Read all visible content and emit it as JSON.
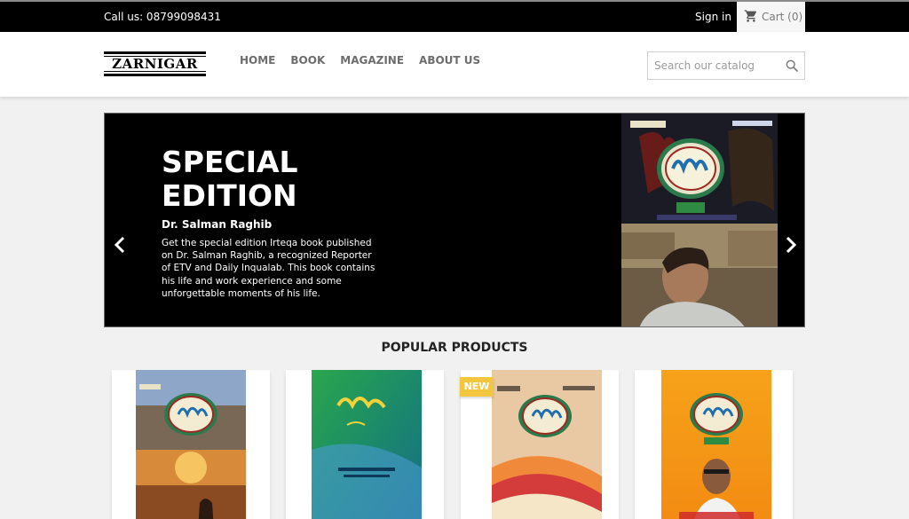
{
  "topbar": {
    "phone": "Call us: 08799098431",
    "signin": "Sign in",
    "cart": "Cart (0)"
  },
  "header": {
    "logo_text": "ZARNIGAR",
    "nav": [
      "HOME",
      "BOOK",
      "MAGAZINE",
      "ABOUT US"
    ],
    "search_placeholder": "Search our catalog"
  },
  "slider": {
    "title": "SPECIAL EDITION",
    "subtitle": "Dr. Salman Raghib",
    "description": "Get the special edition Irteqa book published on Dr. Salman Raghib, a recognized Reporter of ETV and Daily Inqualab. This book contains his life and work experience and some unforgettable moments of his life."
  },
  "popular": {
    "title": "POPULAR PRODUCTS",
    "new_badge": "NEW",
    "products": 4
  },
  "colors": {
    "topbar_bg": "#000000",
    "accent_badge": "#f3c640",
    "nav_text": "#6d6d6d"
  }
}
